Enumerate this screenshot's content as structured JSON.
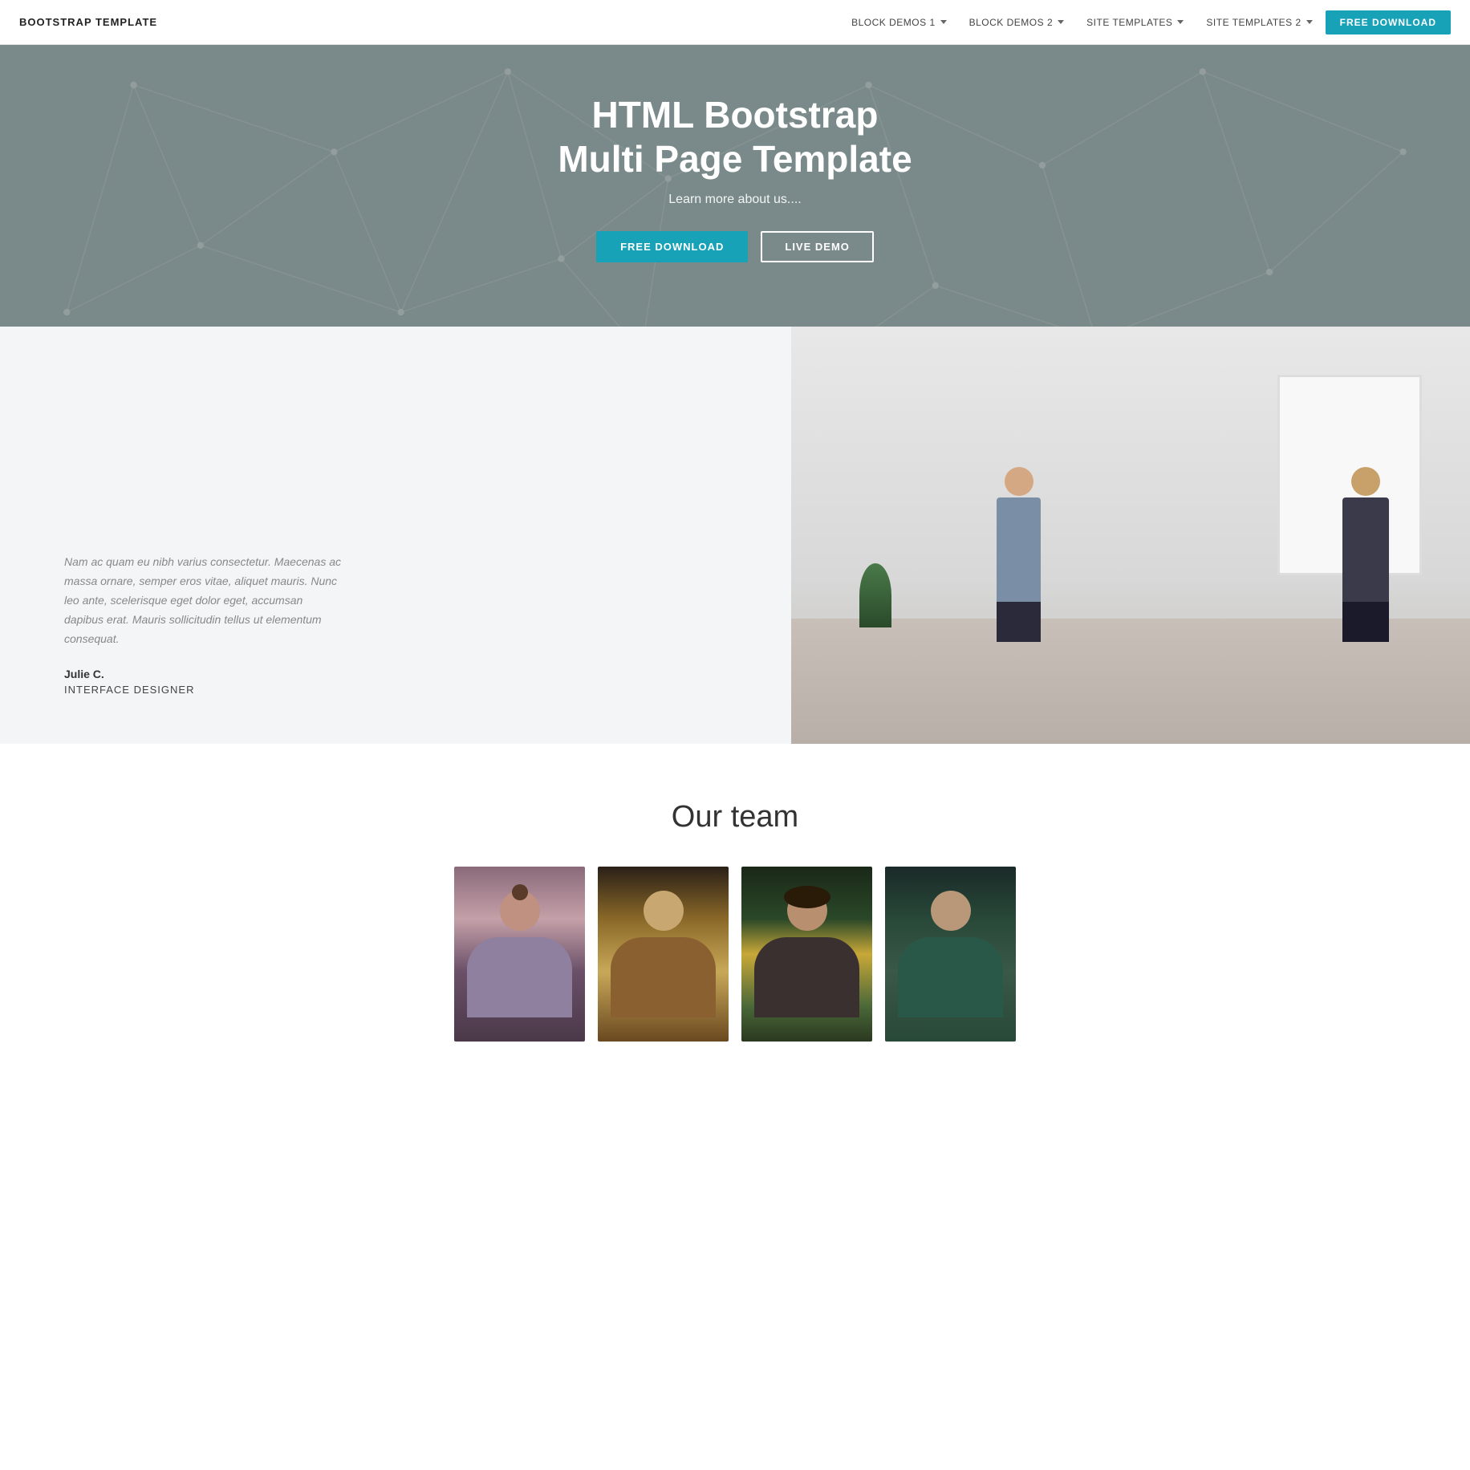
{
  "nav": {
    "brand": "BOOTSTRAP TEMPLATE",
    "links": [
      {
        "label": "BLOCK DEMOS 1",
        "has_dropdown": true
      },
      {
        "label": "BLOCK DEMOS 2",
        "has_dropdown": true
      },
      {
        "label": "SITE TEMPLATES",
        "has_dropdown": true
      },
      {
        "label": "SITE TEMPLATES 2",
        "has_dropdown": true
      }
    ],
    "cta_label": "FREE DOWNLOAD"
  },
  "hero": {
    "title_line1": "HTML Bootstrap",
    "title_line2": "Multi Page Template",
    "subtitle": "Learn more about us....",
    "btn_download": "FREE DOWNLOAD",
    "btn_demo": "LIVE DEMO"
  },
  "about": {
    "quote": "Nam ac quam eu nibh varius consectetur. Maecenas ac massa ornare, semper eros vitae, aliquet mauris. Nunc leo ante, scelerisque eget dolor eget, accumsan dapibus erat. Mauris sollicitudin tellus ut elementum consequat.",
    "name": "Julie C.",
    "role": "INTERFACE DESIGNER"
  },
  "team": {
    "title": "Our team",
    "members": [
      {
        "id": 1,
        "tone": "warm-dark"
      },
      {
        "id": 2,
        "tone": "amber"
      },
      {
        "id": 3,
        "tone": "green-dark"
      },
      {
        "id": 4,
        "tone": "teal-dark"
      }
    ]
  },
  "colors": {
    "accent": "#17a2b8",
    "nav_bg": "#ffffff",
    "hero_bg": "#7a8a8a",
    "section_bg": "#f4f5f6"
  }
}
